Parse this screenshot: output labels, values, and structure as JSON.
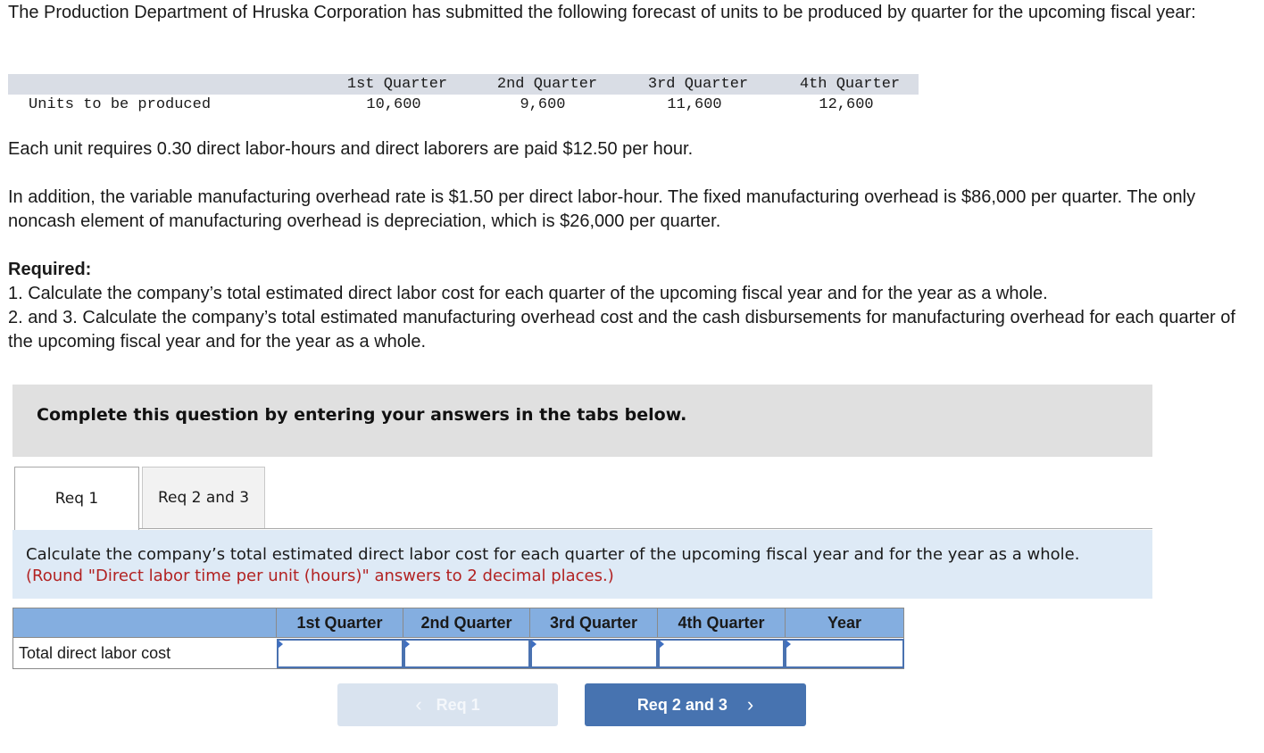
{
  "intro": "The Production Department of Hruska Corporation has submitted the following forecast of units to be produced by quarter for the upcoming fiscal year:",
  "forecast": {
    "headers": [
      "1st Quarter",
      "2nd Quarter",
      "3rd Quarter",
      "4th Quarter"
    ],
    "row_label": "Units to be produced",
    "values": [
      "10,600",
      "9,600",
      "11,600",
      "12,600"
    ]
  },
  "labor_text": "Each unit requires 0.30 direct labor-hours and direct laborers are paid $12.50 per hour.",
  "overhead_text": "In addition, the variable manufacturing overhead rate is $1.50 per direct labor-hour. The fixed manufacturing overhead is $86,000 per quarter. The only noncash element of manufacturing overhead is depreciation, which is $26,000 per quarter.",
  "required": {
    "title": "Required:",
    "items": [
      "1. Calculate the company’s total estimated direct labor cost for each quarter of the upcoming fiscal year and for the year as a whole.",
      "2. and 3. Calculate the company’s total estimated manufacturing overhead cost and the cash disbursements for manufacturing overhead for each quarter of the upcoming fiscal year and for the year as a whole."
    ]
  },
  "banner": "Complete this question by entering your answers in the tabs below.",
  "tabs": [
    {
      "label": "Req 1",
      "active": true
    },
    {
      "label": "Req 2 and 3",
      "active": false
    }
  ],
  "panel": {
    "instruction": "Calculate the company’s total estimated direct labor cost for each quarter of the upcoming fiscal year and for the year as a whole.",
    "note": "(Round \"Direct labor time per unit (hours)\" answers to 2 decimal places.)"
  },
  "answer_table": {
    "headers": [
      "1st Quarter",
      "2nd Quarter",
      "3rd Quarter",
      "4th Quarter",
      "Year"
    ],
    "row_label": "Total direct labor cost",
    "values": [
      "",
      "",
      "",
      "",
      ""
    ]
  },
  "nav": {
    "prev_label": "Req 1",
    "next_label": "Req 2 and 3",
    "prev_icon": "‹",
    "next_icon": "›"
  },
  "colors": {
    "table_header": "#84aee0",
    "panel_bg": "#deeaf6",
    "note_red": "#b22222",
    "next_button": "#4773b0",
    "prev_button_disabled": "#d9e3ef"
  }
}
